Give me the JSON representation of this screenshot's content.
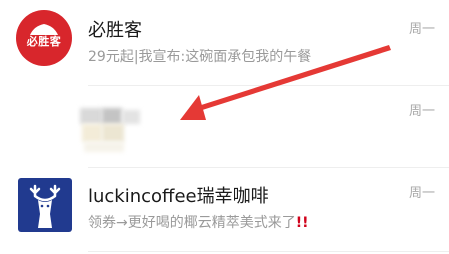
{
  "chats": [
    {
      "name": "必胜客",
      "preview": "29元起|我宣布:这碗面承包我的午餐",
      "time": "周一",
      "avatar_text": "必胜客",
      "avatar_color": "#d8262c"
    },
    {
      "name": "",
      "preview": "",
      "time": "周一"
    },
    {
      "name": "luckincoffee瑞幸咖啡",
      "preview": "领券→更好喝的椰云精萃美式来了",
      "preview_suffix": "!!",
      "time": "周一",
      "avatar_color": "#213a8f"
    }
  ],
  "colors": {
    "arrow": "#e53935",
    "accent_red": "#d0021b"
  }
}
